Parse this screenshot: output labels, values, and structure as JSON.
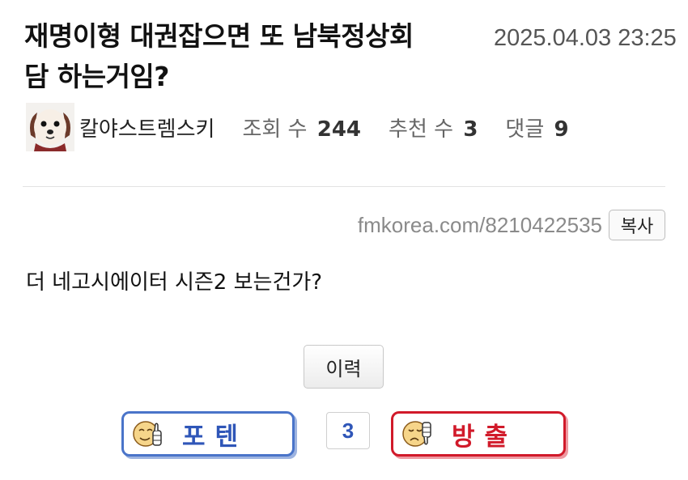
{
  "post": {
    "title_line1": "재명이형 대권잡으면 또 남북정상회",
    "title_line2": "담 하는거임?",
    "date": "2025.04.03 23:25",
    "author": "칼야스트렘스키",
    "views_label": "조회 수",
    "views": "244",
    "recommend_label": "추천 수",
    "recommend": "3",
    "comments_label": "댓글",
    "comments": "9",
    "url": "fmkorea.com/8210422535",
    "copy_label": "복사",
    "body": "더 네고시에이터 시즌2 보는건가?",
    "history_label": "이력"
  },
  "vote": {
    "up_label": "포텐",
    "count": "3",
    "down_label": "방출",
    "up_color": "#4a74c9",
    "down_color": "#d11a2a"
  },
  "icons": {
    "avatar": "dog-avatar-icon",
    "up": "thumbs-up-face-icon",
    "down": "thumbs-down-face-icon"
  }
}
